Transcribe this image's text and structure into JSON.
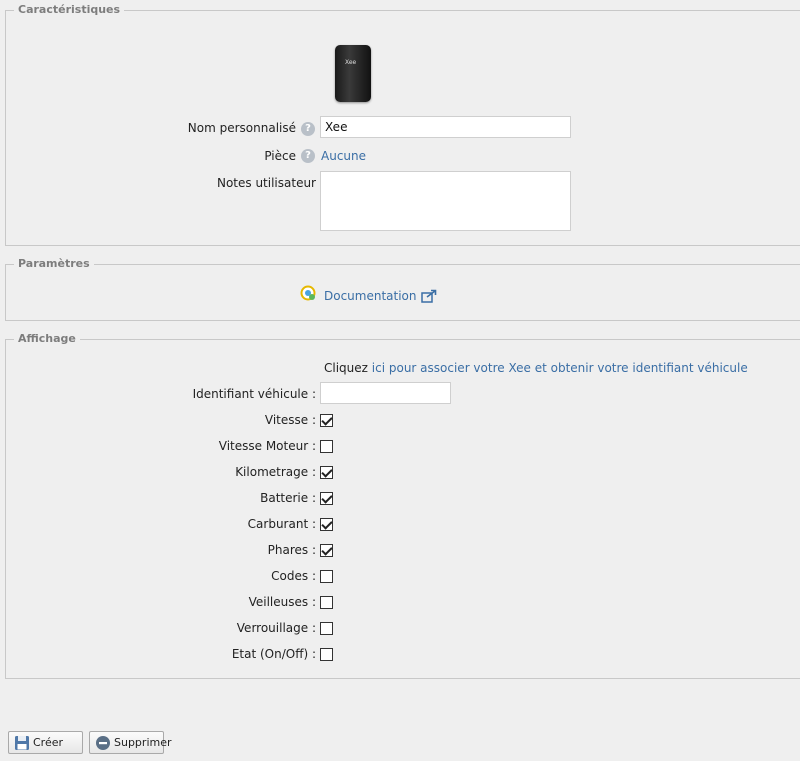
{
  "characteristics": {
    "legend": "Caractéristiques",
    "device_image_text": "Xee",
    "custom_name_label": "Nom personnalisé",
    "custom_name_value": "Xee",
    "room_label": "Pièce",
    "room_value": "Aucune",
    "notes_label": "Notes utilisateur",
    "notes_value": "",
    "help_glyph": "?"
  },
  "parameters": {
    "legend": "Paramètres",
    "documentation_label": "Documentation",
    "doc_icon": "plugin-badge-icon",
    "external_icon": "external-link-icon"
  },
  "display": {
    "legend": "Affichage",
    "info_prefix": "Cliquez",
    "info_link": "ici pour associer votre Xee et obtenir votre identifiant véhicule",
    "vehicle_id_label": "Identifiant véhicule :",
    "vehicle_id_value": "",
    "options": [
      {
        "label": "Vitesse :",
        "checked": true
      },
      {
        "label": "Vitesse Moteur :",
        "checked": false
      },
      {
        "label": "Kilometrage :",
        "checked": true
      },
      {
        "label": "Batterie :",
        "checked": true
      },
      {
        "label": "Carburant :",
        "checked": true
      },
      {
        "label": "Phares :",
        "checked": true
      },
      {
        "label": "Codes :",
        "checked": false
      },
      {
        "label": "Veilleuses :",
        "checked": false
      },
      {
        "label": "Verrouillage :",
        "checked": false
      },
      {
        "label": "Etat (On/Off) :",
        "checked": false
      }
    ]
  },
  "actions": {
    "create_label": "Créer",
    "delete_label": "Supprimer",
    "create_icon": "floppy-disk-icon",
    "delete_icon": "minus-circle-icon"
  }
}
